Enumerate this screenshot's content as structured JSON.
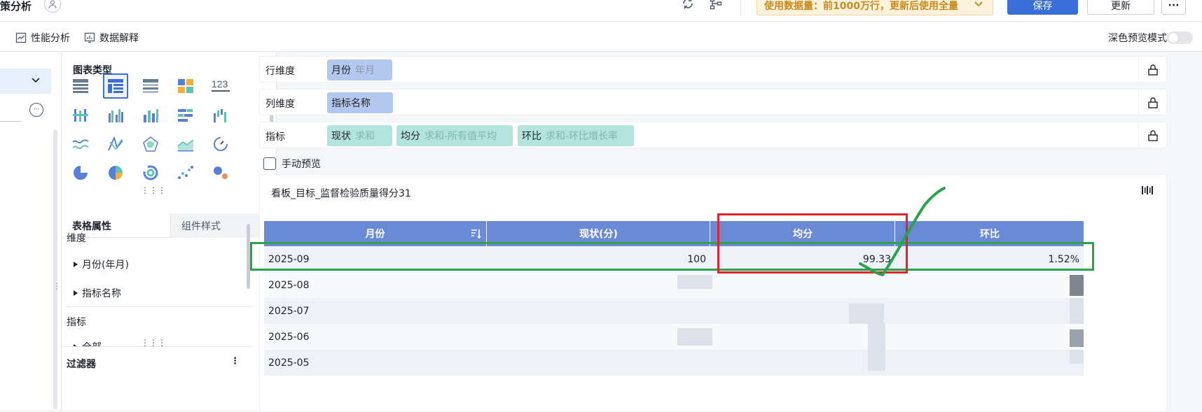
{
  "topbar": {
    "title": "策分析",
    "banner": "使用数据量：前1000万行，更新后使用全量",
    "save_label": "保存",
    "update_label": "更新",
    "more_label": "···"
  },
  "subbar": {
    "perf_label": "性能分析",
    "explain_label": "数据解释",
    "dark_mode_label": "深色预览模式"
  },
  "chart_panel": {
    "title": "图表类型",
    "kpi_label": "123",
    "tab_table_props": "表格属性",
    "tab_component": "组件样式",
    "dimension_label": "维度",
    "dim_items": [
      "月份(年月)",
      "指标名称"
    ],
    "measure_label": "指标",
    "measure_item_partial": "全部",
    "filter_label": "过滤器"
  },
  "shelves": {
    "row": {
      "label": "行维度",
      "pills": [
        {
          "name": "月份",
          "sub": "年月"
        }
      ]
    },
    "col": {
      "label": "列维度",
      "pills": [
        {
          "name": "指标名称",
          "sub": ""
        }
      ]
    },
    "measure": {
      "label": "指标",
      "pills": [
        {
          "name": "现状",
          "sub": "求和"
        },
        {
          "name": "均分",
          "sub": "求和-所有值平均"
        },
        {
          "name": "环比",
          "sub": "求和-环比增长率"
        }
      ]
    }
  },
  "manual_preview_label": "手动预览",
  "chart": {
    "title": "看板_目标_监督检验质量得分31",
    "columns": [
      "月份",
      "现状(分)",
      "均分",
      "环比"
    ],
    "rows": [
      [
        "2025-09",
        "100",
        "99.33",
        "1.52%"
      ],
      [
        "2025-08",
        "",
        "",
        ""
      ],
      [
        "2025-07",
        "",
        "",
        ""
      ],
      [
        "2025-06",
        "",
        "",
        ""
      ],
      [
        "2025-05",
        "",
        "",
        ""
      ]
    ]
  },
  "colors": {
    "primary": "#3a6fd9",
    "header": "#6b8ad6",
    "annotation_green": "#2aa34a",
    "annotation_red": "#e0242b"
  }
}
